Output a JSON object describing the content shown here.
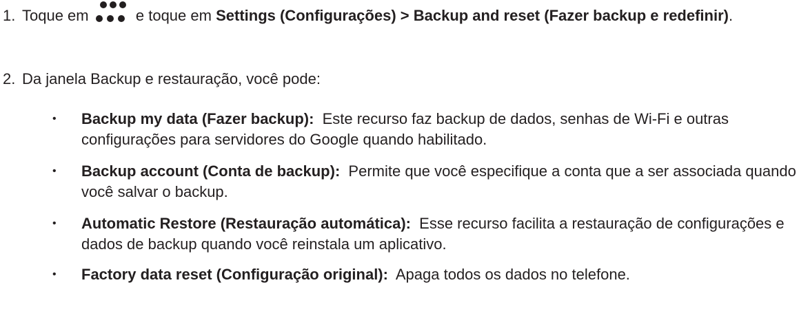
{
  "steps": [
    {
      "number": "1.",
      "before_icon": "Toque em",
      "icon": "three-dots-menu-icon",
      "after_icon": "e toque em",
      "bold_text": "Settings (Configurações) > Backup and reset (Fazer backup e redefinir)",
      "end": "."
    },
    {
      "number": "2.",
      "text": "Da janela Backup e restauração, você pode:"
    }
  ],
  "bullets": [
    {
      "mark": "•",
      "title": "Backup my data (Fazer backup):",
      "text": "Este recurso faz backup de dados, senhas de Wi-Fi e outras configurações para servidores do Google quando habilitado."
    },
    {
      "mark": "•",
      "title": "Backup account (Conta de backup):",
      "text": "Permite que você especifique a conta que a ser associada quando você salvar o backup."
    },
    {
      "mark": "•",
      "title": "Automatic Restore (Restauração automática):",
      "text": "Esse recurso facilita a restauração de configurações e dados de backup quando você reinstala um aplicativo."
    },
    {
      "mark": "•",
      "title": "Factory data reset (Configuração original):",
      "text": "Apaga todos os dados no telefone."
    }
  ]
}
